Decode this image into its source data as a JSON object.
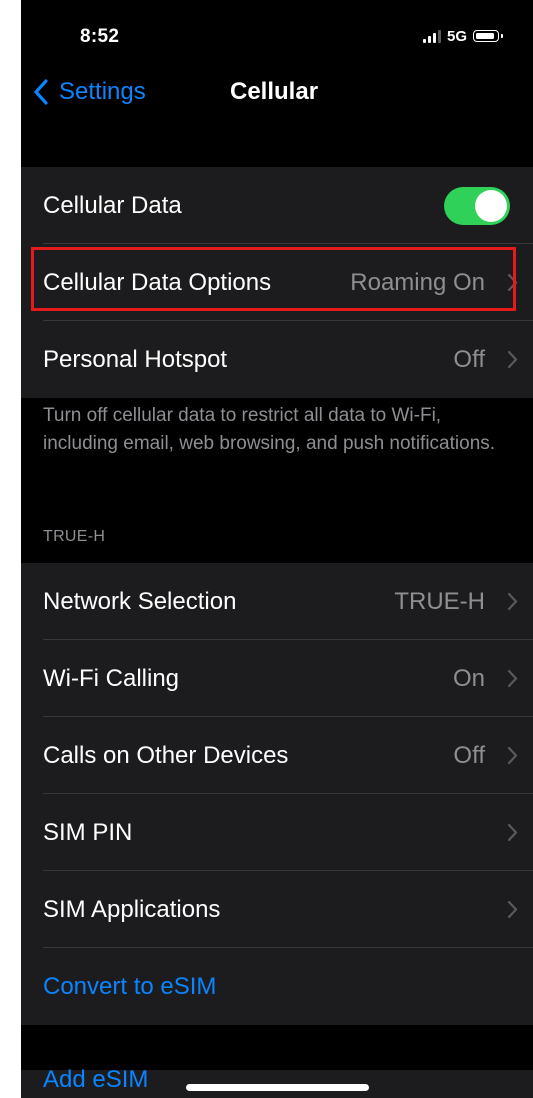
{
  "status_bar": {
    "time": "8:52",
    "network": "5G"
  },
  "nav": {
    "back_label": "Settings",
    "title": "Cellular"
  },
  "group1": {
    "cellular_data": {
      "label": "Cellular Data",
      "toggle_on": true
    },
    "cellular_data_options": {
      "label": "Cellular Data Options",
      "value": "Roaming On"
    },
    "personal_hotspot": {
      "label": "Personal Hotspot",
      "value": "Off"
    }
  },
  "footer_text": "Turn off cellular data to restrict all data to Wi-Fi, including email, web browsing, and push notifications.",
  "section_header": "TRUE-H",
  "group2": {
    "network_selection": {
      "label": "Network Selection",
      "value": "TRUE-H"
    },
    "wifi_calling": {
      "label": "Wi-Fi Calling",
      "value": "On"
    },
    "calls_other_devices": {
      "label": "Calls on Other Devices",
      "value": "Off"
    },
    "sim_pin": {
      "label": "SIM PIN"
    },
    "sim_applications": {
      "label": "SIM Applications"
    },
    "convert_esim": {
      "label": "Convert to eSIM"
    }
  },
  "partial_row": {
    "label": "Add eSIM"
  },
  "colors": {
    "accent": "#0a84ff",
    "toggle_on": "#30d158",
    "highlight": "#e31b1b"
  }
}
